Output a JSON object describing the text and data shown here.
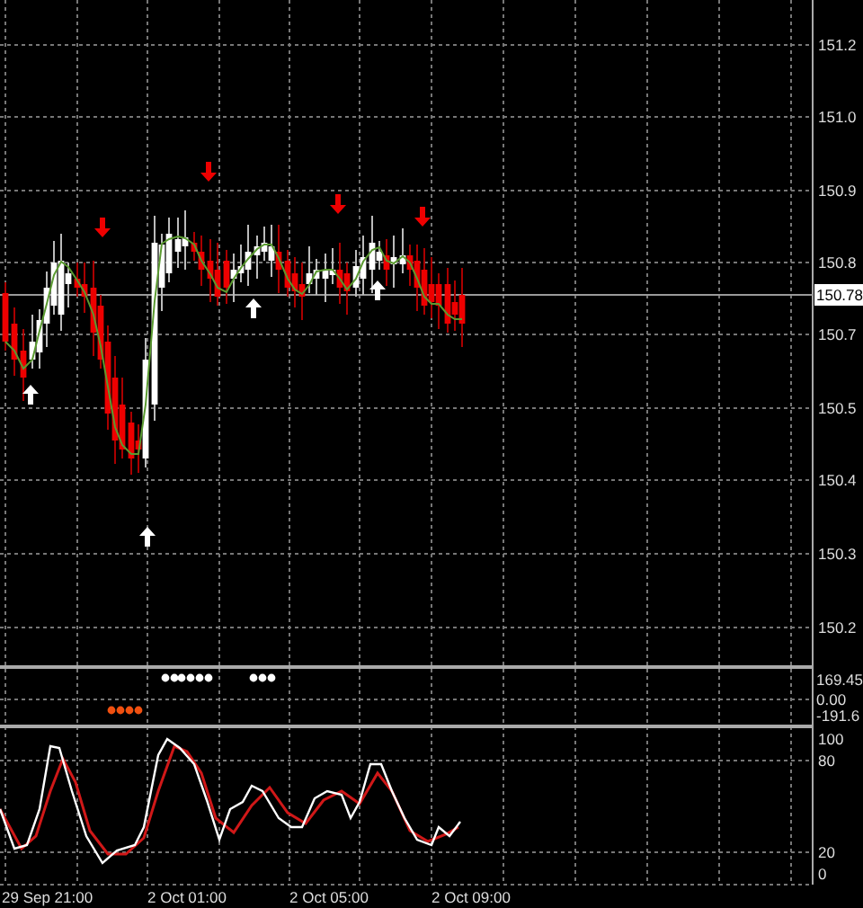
{
  "price_axis": {
    "labels": [
      "151.2",
      "151.0",
      "150.9",
      "150.8",
      "150.7",
      "150.5",
      "150.4",
      "150.3",
      "150.2"
    ],
    "current_price": "150.78"
  },
  "signal_panel": {
    "axis_labels": [
      "169.45",
      "0.00",
      "-191.6"
    ]
  },
  "stochastic_panel": {
    "axis_labels": [
      "100",
      "80",
      "20",
      "0"
    ]
  },
  "time_axis": {
    "labels": [
      "29 Sep 21:00",
      "2 Oct 01:00",
      "2 Oct 05:00",
      "2 Oct 09:00"
    ]
  }
}
